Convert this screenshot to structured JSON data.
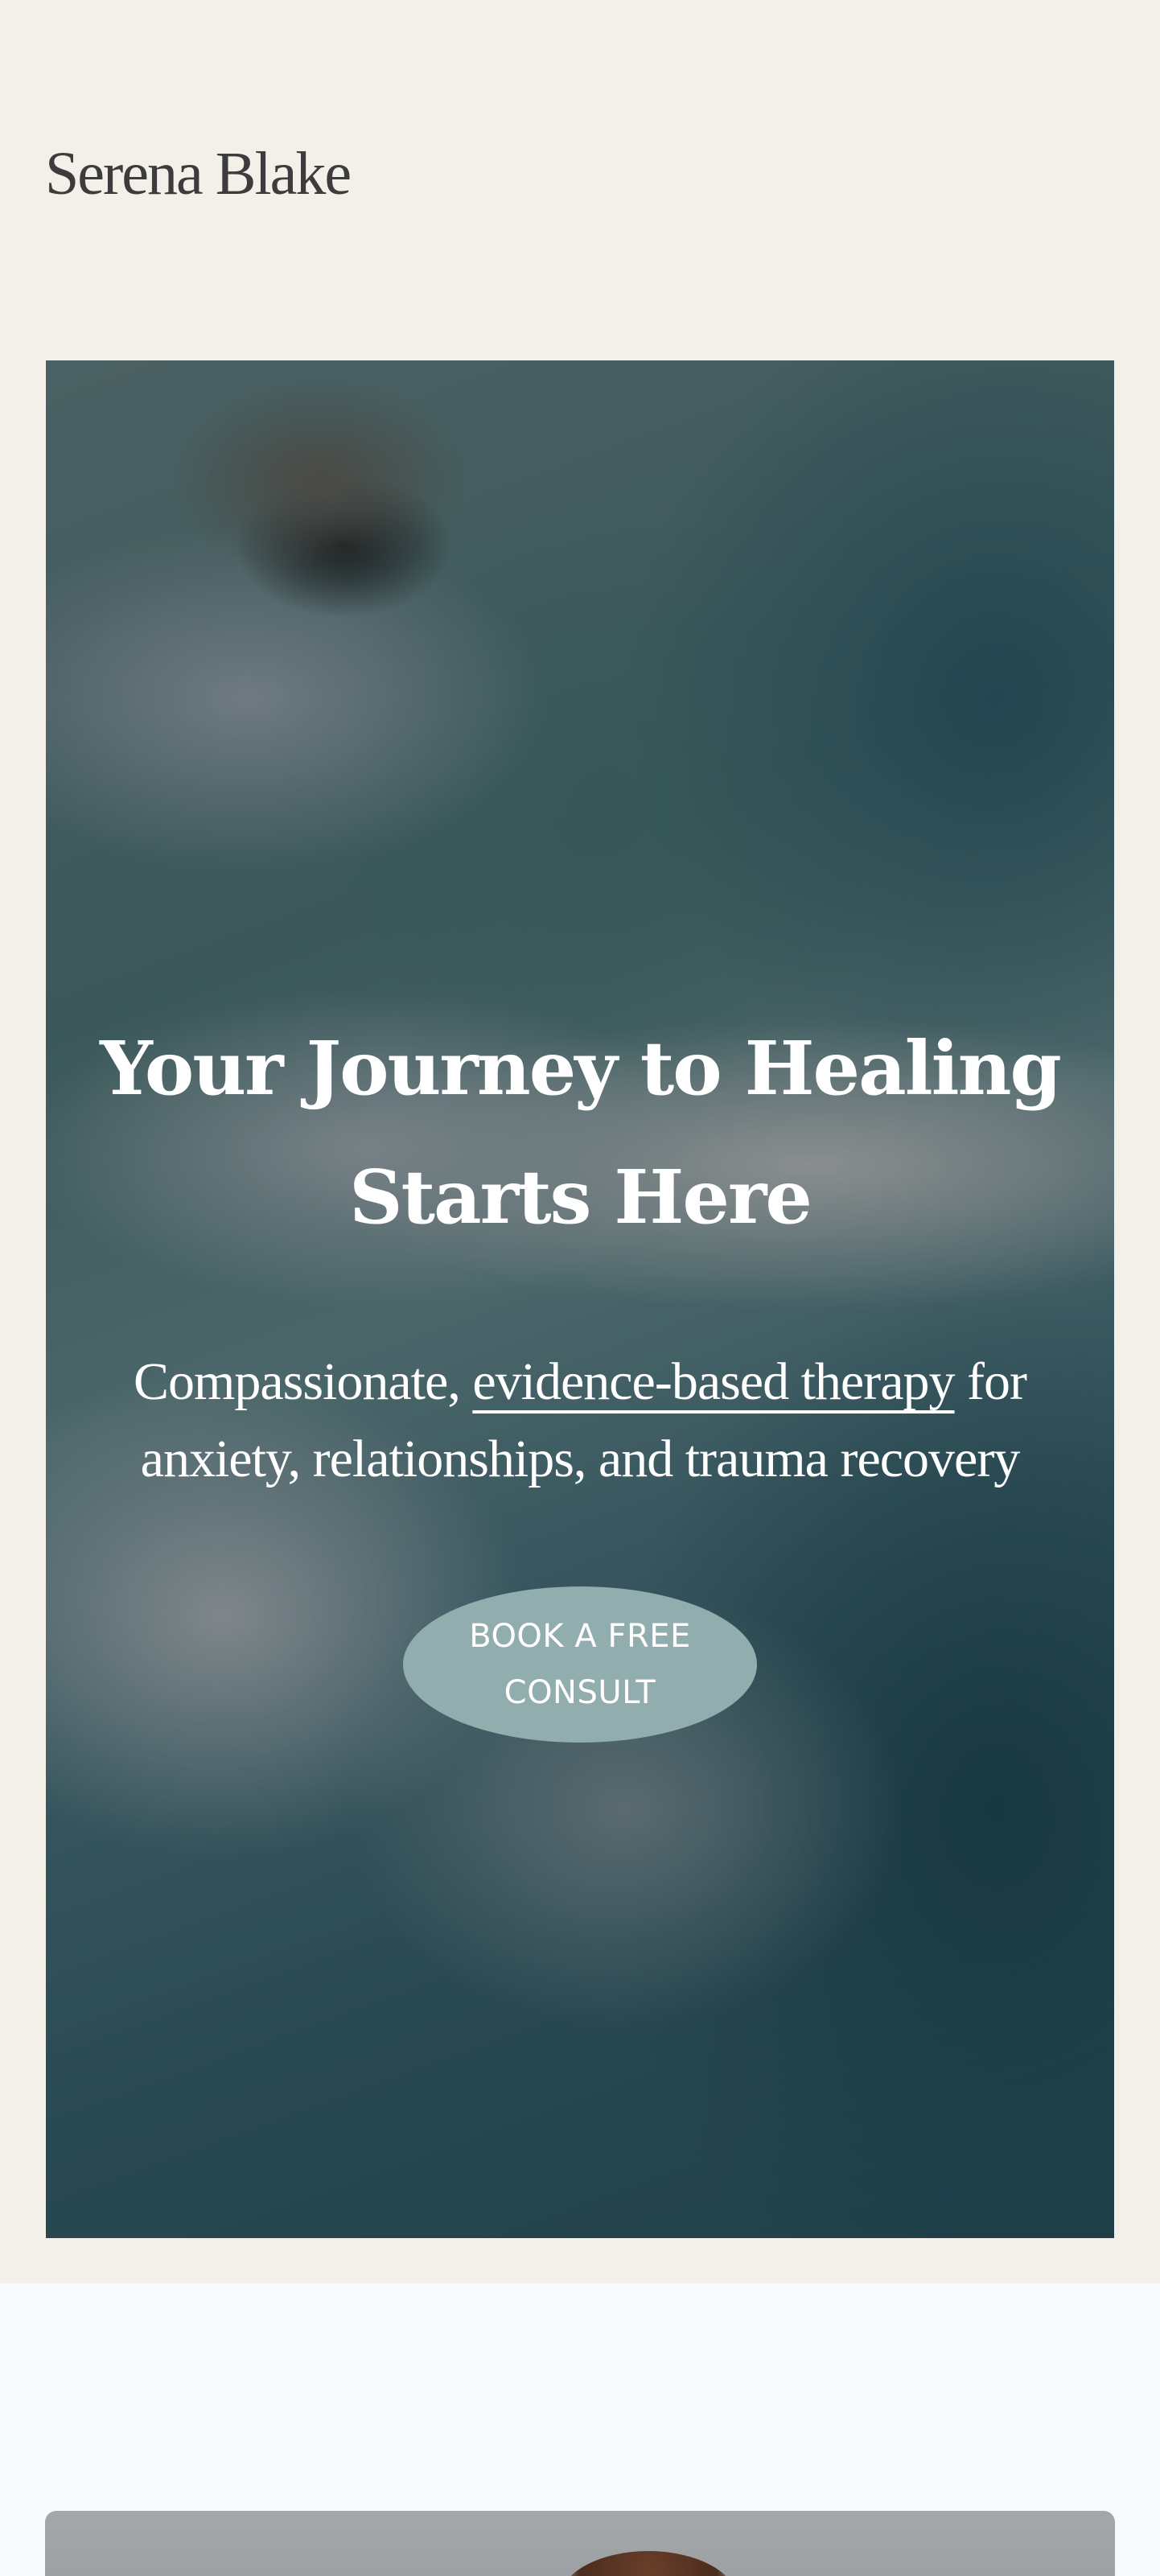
{
  "site": {
    "brand_name": "Serena Blake"
  },
  "hero": {
    "title_line1": "Your Journey to Healing",
    "title_line2": "Starts Here",
    "subtitle_before": "Compassionate, ",
    "subtitle_link": "evidence-based therapy",
    "subtitle_after": " for anxiety, relationships, and trauma recovery",
    "cta_label": "BOOK A FREE CONSULT",
    "background": "blurred-ocean-waves-photo"
  },
  "about": {
    "photo": "therapist-portrait-photo"
  },
  "colors": {
    "page_background": "#f3f0ea",
    "section_background": "#f8f9fb",
    "cta_background": "#91adad",
    "hero_text": "#ffffff",
    "brand_text": "#3c3c3c"
  }
}
